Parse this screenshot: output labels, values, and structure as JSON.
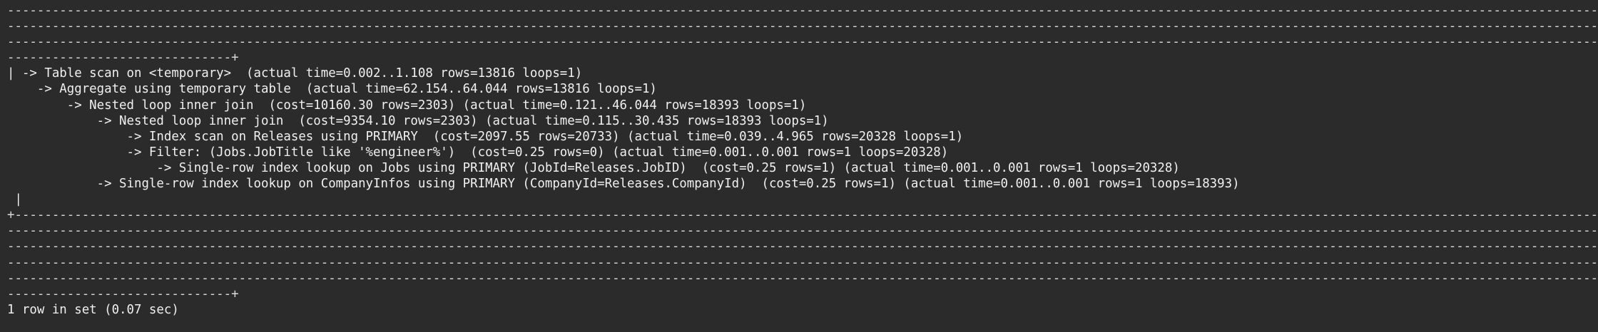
{
  "terminal": {
    "border_lines": [
      "----------------------------------------------------------------------------------------------------------------------------------------------------------------------------------------------------------------------------",
      "----------------------------------------------------------------------------------------------------------------------------------------------------------------------------------------------------------------------------",
      "----------------------------------------------------------------------------------------------------------------------------------------------------------------------------------------------------------------------------",
      "------------------------------+"
    ],
    "plan_lines": [
      "| -> Table scan on <temporary>  (actual time=0.002..1.108 rows=13816 loops=1)",
      "    -> Aggregate using temporary table  (actual time=62.154..64.044 rows=13816 loops=1)",
      "        -> Nested loop inner join  (cost=10160.30 rows=2303) (actual time=0.121..46.044 rows=18393 loops=1)",
      "            -> Nested loop inner join  (cost=9354.10 rows=2303) (actual time=0.115..30.435 rows=18393 loops=1)",
      "                -> Index scan on Releases using PRIMARY  (cost=2097.55 rows=20733) (actual time=0.039..4.965 rows=20328 loops=1)",
      "                -> Filter: (Jobs.JobTitle like '%engineer%')  (cost=0.25 rows=0) (actual time=0.001..0.001 rows=1 loops=20328)",
      "                    -> Single-row index lookup on Jobs using PRIMARY (JobId=Releases.JobID)  (cost=0.25 rows=1) (actual time=0.001..0.001 rows=1 loops=20328)",
      "            -> Single-row index lookup on CompanyInfos using PRIMARY (CompanyId=Releases.CompanyId)  (cost=0.25 rows=1) (actual time=0.001..0.001 rows=1 loops=18393)",
      " |"
    ],
    "bottom_border_lines": [
      "+---------------------------------------------------------------------------------------------------------------------------------------------------------------------------------------------------------------------------",
      "----------------------------------------------------------------------------------------------------------------------------------------------------------------------------------------------------------------------------",
      "----------------------------------------------------------------------------------------------------------------------------------------------------------------------------------------------------------------------------",
      "----------------------------------------------------------------------------------------------------------------------------------------------------------------------------------------------------------------------------",
      "----------------------------------------------------------------------------------------------------------------------------------------------------------------------------------------------------------------------------",
      "------------------------------+"
    ],
    "status_line": "1 row in set (0.07 sec)"
  }
}
